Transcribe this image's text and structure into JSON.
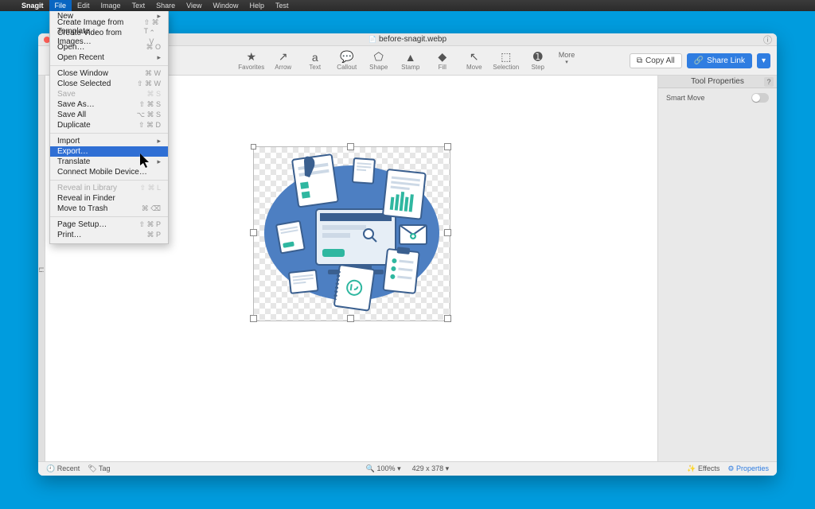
{
  "menubar": {
    "app": "Snagit",
    "items": [
      "File",
      "Edit",
      "Image",
      "Text",
      "Share",
      "View",
      "Window",
      "Help",
      "Test"
    ],
    "open_index": 0
  },
  "file_menu": {
    "groups": [
      [
        {
          "label": "New",
          "shortcut": "",
          "submenu": true
        },
        {
          "label": "Create Image from Template…",
          "shortcut": "⇧ ⌘ T"
        },
        {
          "label": "Create Video from Images…",
          "shortcut": "⌃ V"
        },
        {
          "label": "Open…",
          "shortcut": "⌘ O"
        },
        {
          "label": "Open Recent",
          "shortcut": "",
          "submenu": true
        }
      ],
      [
        {
          "label": "Close Window",
          "shortcut": "⌘ W"
        },
        {
          "label": "Close Selected",
          "shortcut": "⇧ ⌘ W"
        },
        {
          "label": "Save",
          "shortcut": "⌘ S",
          "disabled": true
        },
        {
          "label": "Save As…",
          "shortcut": "⇧ ⌘ S"
        },
        {
          "label": "Save All",
          "shortcut": "⌥ ⌘ S"
        },
        {
          "label": "Duplicate",
          "shortcut": "⇧ ⌘ D"
        }
      ],
      [
        {
          "label": "Import",
          "shortcut": "",
          "submenu": true
        },
        {
          "label": "Export…",
          "shortcut": "",
          "highlight": true
        },
        {
          "label": "Translate",
          "shortcut": "",
          "submenu": true
        },
        {
          "label": "Connect Mobile Device…",
          "shortcut": ""
        }
      ],
      [
        {
          "label": "Reveal in Library",
          "shortcut": "⇧ ⌘ L",
          "disabled": true
        },
        {
          "label": "Reveal in Finder",
          "shortcut": ""
        },
        {
          "label": "Move to Trash",
          "shortcut": "⌘ ⌫"
        }
      ],
      [
        {
          "label": "Page Setup…",
          "shortcut": "⇧ ⌘ P"
        },
        {
          "label": "Print…",
          "shortcut": "⌘ P"
        }
      ]
    ]
  },
  "window": {
    "title": "before-snagit.webp",
    "sidebar_label": "Li"
  },
  "toolbar": {
    "tools": [
      {
        "label": "Favorites",
        "glyph": "★"
      },
      {
        "label": "Arrow",
        "glyph": "↗"
      },
      {
        "label": "Text",
        "glyph": "a"
      },
      {
        "label": "Callout",
        "glyph": "💬"
      },
      {
        "label": "Shape",
        "glyph": "⬠"
      },
      {
        "label": "Stamp",
        "glyph": "▲"
      },
      {
        "label": "Fill",
        "glyph": "◆"
      },
      {
        "label": "Move",
        "glyph": "↖"
      },
      {
        "label": "Selection",
        "glyph": "⬚"
      },
      {
        "label": "Step",
        "glyph": "➊"
      }
    ],
    "more": "More",
    "copy_all": "Copy All",
    "share": "Share Link"
  },
  "properties": {
    "title": "Tool Properties",
    "smart_move": "Smart Move"
  },
  "statusbar": {
    "recent": "Recent",
    "tag": "Tag",
    "zoom": "100%",
    "dims": "429 x 378",
    "effects": "Effects",
    "properties": "Properties"
  }
}
